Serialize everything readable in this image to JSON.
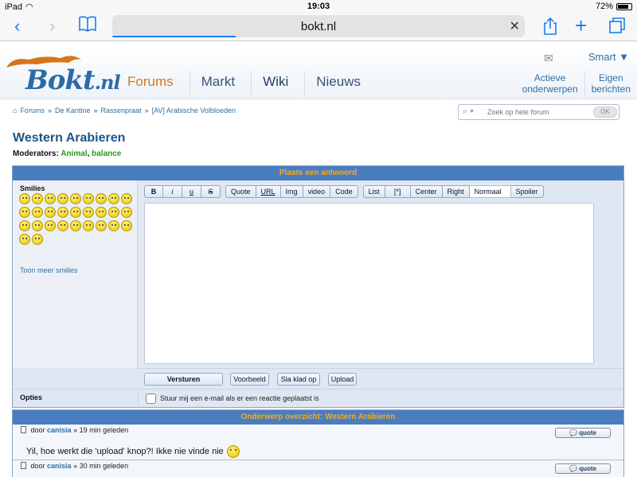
{
  "status_bar": {
    "device": "iPad",
    "time": "19:03",
    "battery": "72%",
    "battery_level": 0.72
  },
  "browser": {
    "url": "bokt.nl",
    "load_progress": 0.3
  },
  "site": {
    "logo_text": "Bokt",
    "logo_suffix": ".nl",
    "nav": {
      "forums": "Forums",
      "markt": "Markt",
      "wiki": "Wiki",
      "nieuws": "Nieuws"
    },
    "smart_label": "Smart ▼",
    "right_nav": {
      "actieve_1": "Actieve",
      "actieve_2": "onderwerpen",
      "eigen_1": "Eigen",
      "eigen_2": "berichten"
    }
  },
  "breadcrumb": {
    "forums": "Forums",
    "kantine": "De Kantine",
    "rassenpraat": "Rassenpraat",
    "current": "[AV] Arabische Volbloeden",
    "separator": "»"
  },
  "search": {
    "placeholder": "Zoek op hele forum",
    "ok_label": "OK"
  },
  "page": {
    "title": "Western Arabieren",
    "moderators_label": "Moderators:",
    "moderator_1": "Animal",
    "moderator_2": "balance"
  },
  "reply": {
    "header": "Plaats een antwoord",
    "smilies_label": "Smilies",
    "more_smilies": "Toon meer smilies",
    "toolbar": {
      "bold": "B",
      "italic": "i",
      "underline": "u",
      "strike": "S",
      "quote": "Quote",
      "url": "URL",
      "img": "Img",
      "video": "video",
      "code": "Code",
      "list": "List",
      "item": "[*]",
      "center": "Center",
      "right": "Right",
      "size": "Normaal",
      "spoiler": "Spoiler"
    },
    "buttons": {
      "send": "Versturen",
      "preview": "Voorbeeld",
      "draft": "Sla klad op",
      "upload": "Upload"
    },
    "options_label": "Opties",
    "notify_text": "Stuur mij een e-mail als er een reactie geplaatst is"
  },
  "overview": {
    "header": "Onderwerp overzicht: Western Arabieren",
    "quote_label": "quote",
    "posts": [
      {
        "prefix": "door",
        "user": "canisia",
        "time": "» 19 min geleden",
        "text": "Yil, hoe werkt die 'upload' knop?! Ikke nie vinde nie"
      },
      {
        "prefix": "door",
        "user": "canisia",
        "time": "» 30 min geleden",
        "text": ""
      }
    ]
  },
  "colors": {
    "accent": "#1a7cf5",
    "panel_header": "#4a7dbf",
    "header_text": "#f9a91b",
    "moderator": "#2a9a1b"
  }
}
